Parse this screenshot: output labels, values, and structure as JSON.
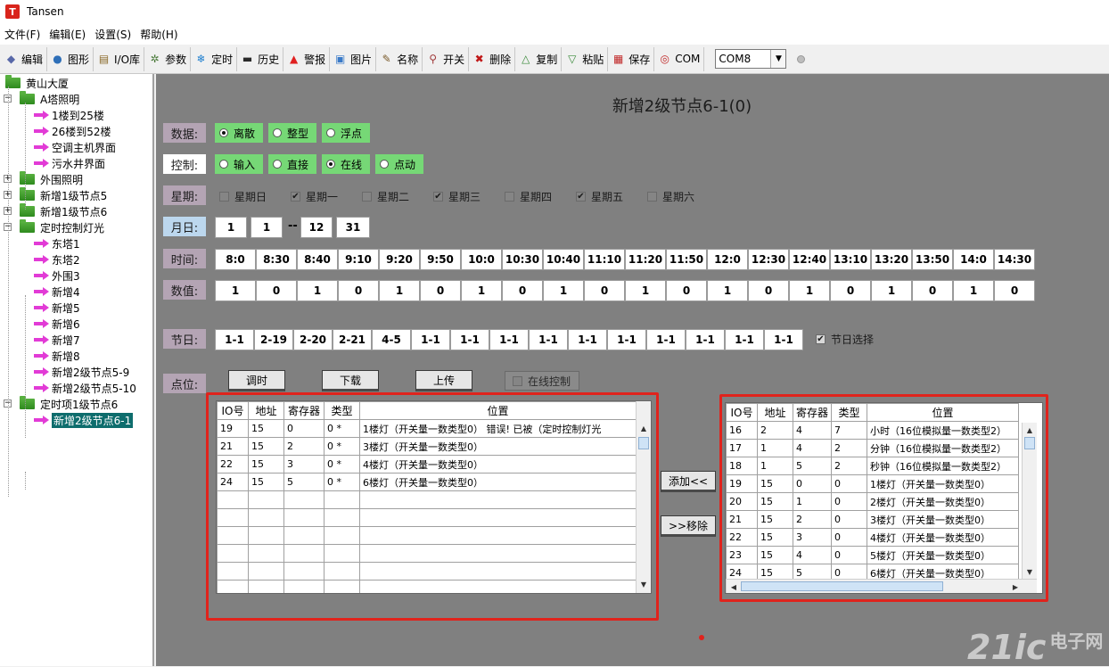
{
  "app": {
    "title": "Tansen",
    "icon_letter": "T"
  },
  "menu": [
    "文件(F)",
    "编辑(E)",
    "设置(S)",
    "帮助(H)"
  ],
  "toolbar": [
    {
      "label": "编辑",
      "icon": "edit-icon",
      "glyph": "◆",
      "color": "#5868a8"
    },
    {
      "label": "图形",
      "icon": "globe-icon",
      "glyph": "●",
      "color": "#2f6fb8"
    },
    {
      "label": "I/O库",
      "icon": "library-icon",
      "glyph": "▤",
      "color": "#8a6a2a"
    },
    {
      "label": "参数",
      "icon": "gear-icon",
      "glyph": "✲",
      "color": "#4a7a3a"
    },
    {
      "label": "定时",
      "icon": "snowflake-icon",
      "glyph": "❄",
      "color": "#1f7fcf"
    },
    {
      "label": "历史",
      "icon": "monitor-icon",
      "glyph": "▬",
      "color": "#2a2a2a"
    },
    {
      "label": "警报",
      "icon": "alarm-icon",
      "glyph": "▲",
      "color": "#e02020"
    },
    {
      "label": "图片",
      "icon": "picture-icon",
      "glyph": "▣",
      "color": "#3a7ac8"
    },
    {
      "label": "名称",
      "icon": "name-edit-icon",
      "glyph": "✎",
      "color": "#7a5a2a"
    },
    {
      "label": "开关",
      "icon": "search-icon",
      "glyph": "⚲",
      "color": "#a03a3a"
    },
    {
      "label": "删除",
      "icon": "delete-icon",
      "glyph": "✖",
      "color": "#c01818"
    },
    {
      "label": "复制",
      "icon": "up-arrow-icon",
      "glyph": "△",
      "color": "#3a8a3a"
    },
    {
      "label": "粘贴",
      "icon": "down-arrow-icon",
      "glyph": "▽",
      "color": "#3a8a3a"
    },
    {
      "label": "保存",
      "icon": "calendar-icon",
      "glyph": "▦",
      "color": "#c02828"
    },
    {
      "label": "COM",
      "icon": "com-icon",
      "glyph": "◎",
      "color": "#c02828"
    }
  ],
  "com_port": "COM8",
  "tree": [
    {
      "label": "黄山大厦",
      "level": 0,
      "type": "folder",
      "exp": ""
    },
    {
      "label": "A塔照明",
      "level": 1,
      "type": "folder",
      "exp": "−"
    },
    {
      "label": "1楼到25楼",
      "level": 2,
      "type": "arrow"
    },
    {
      "label": "26楼到52楼",
      "level": 2,
      "type": "arrow"
    },
    {
      "label": "空调主机界面",
      "level": 2,
      "type": "arrow"
    },
    {
      "label": "污水井界面",
      "level": 2,
      "type": "arrow"
    },
    {
      "label": "外围照明",
      "level": 1,
      "type": "folder",
      "exp": "+"
    },
    {
      "label": "新增1级节点5",
      "level": 1,
      "type": "folder",
      "exp": "+"
    },
    {
      "label": "新增1级节点6",
      "level": 1,
      "type": "folder",
      "exp": "+"
    },
    {
      "label": "定时控制灯光",
      "level": 1,
      "type": "folder",
      "exp": "−"
    },
    {
      "label": "东塔1",
      "level": 2,
      "type": "arrow"
    },
    {
      "label": "东塔2",
      "level": 2,
      "type": "arrow"
    },
    {
      "label": "外围3",
      "level": 2,
      "type": "arrow"
    },
    {
      "label": "新增4",
      "level": 2,
      "type": "arrow"
    },
    {
      "label": "新增5",
      "level": 2,
      "type": "arrow"
    },
    {
      "label": "新增6",
      "level": 2,
      "type": "arrow"
    },
    {
      "label": "新增7",
      "level": 2,
      "type": "arrow"
    },
    {
      "label": "新增8",
      "level": 2,
      "type": "arrow"
    },
    {
      "label": "新增2级节点5-9",
      "level": 2,
      "type": "arrow"
    },
    {
      "label": "新增2级节点5-10",
      "level": 2,
      "type": "arrow"
    },
    {
      "label": "定时项1级节点6",
      "level": 1,
      "type": "folder",
      "exp": "−"
    },
    {
      "label": "新增2级节点6-1",
      "level": 2,
      "type": "arrow",
      "selected": true
    }
  ],
  "page_title": "新增2级节点6-1(0)",
  "labels": {
    "data": "数据:",
    "control": "控制:",
    "week": "星期:",
    "monthday": "月日:",
    "time": "时间:",
    "value": "数值:",
    "holiday": "节日:",
    "point": "点位:"
  },
  "data_types": [
    {
      "label": "离散",
      "on": true
    },
    {
      "label": "整型",
      "on": false
    },
    {
      "label": "浮点",
      "on": false
    }
  ],
  "control_modes": [
    {
      "label": "输入",
      "on": false
    },
    {
      "label": "直接",
      "on": false
    },
    {
      "label": "在线",
      "on": true
    },
    {
      "label": "点动",
      "on": false
    }
  ],
  "weekdays": [
    {
      "label": "星期日",
      "on": false
    },
    {
      "label": "星期一",
      "on": true
    },
    {
      "label": "星期二",
      "on": false
    },
    {
      "label": "星期三",
      "on": true
    },
    {
      "label": "星期四",
      "on": false
    },
    {
      "label": "星期五",
      "on": true
    },
    {
      "label": "星期六",
      "on": false
    }
  ],
  "monthday": {
    "from_m": "1",
    "from_d": "1",
    "sep": "--",
    "to_m": "12",
    "to_d": "31"
  },
  "times": [
    "8:0",
    "8:30",
    "8:40",
    "9:10",
    "9:20",
    "9:50",
    "10:0",
    "10:30",
    "10:40",
    "11:10",
    "11:20",
    "11:50",
    "12:0",
    "12:30",
    "12:40",
    "13:10",
    "13:20",
    "13:50",
    "14:0",
    "14:30"
  ],
  "values": [
    "1",
    "0",
    "1",
    "0",
    "1",
    "0",
    "1",
    "0",
    "1",
    "0",
    "1",
    "0",
    "1",
    "0",
    "1",
    "0",
    "1",
    "0",
    "1",
    "0"
  ],
  "holidays": [
    "1-1",
    "2-19",
    "2-20",
    "2-21",
    "4-5",
    "1-1",
    "1-1",
    "1-1",
    "1-1",
    "1-1",
    "1-1",
    "1-1",
    "1-1",
    "1-1",
    "1-1"
  ],
  "holiday_select": {
    "label": "节日选择",
    "on": true
  },
  "buttons": {
    "adjust": "调时",
    "download": "下载",
    "upload": "上传",
    "online": "在线控制",
    "add": "添加<<",
    "remove": ">>移除"
  },
  "left_table": {
    "headers": [
      "IO号",
      "地址",
      "寄存器",
      "类型",
      "位置"
    ],
    "rows": [
      [
        "19",
        "15",
        "0",
        "0 *",
        "1楼灯（开关量一数类型0）  错误! 已被（定时控制灯光"
      ],
      [
        "21",
        "15",
        "2",
        "0 *",
        "3楼灯（开关量一数类型0）"
      ],
      [
        "22",
        "15",
        "3",
        "0 *",
        "4楼灯（开关量一数类型0）"
      ],
      [
        "24",
        "15",
        "5",
        "0 *",
        "6楼灯（开关量一数类型0）"
      ]
    ]
  },
  "right_table": {
    "headers": [
      "IO号",
      "地址",
      "寄存器",
      "类型",
      "位置"
    ],
    "rows": [
      [
        "16",
        "2",
        "4",
        "7",
        "小时（16位模拟量一数类型2）"
      ],
      [
        "17",
        "1",
        "4",
        "2",
        "分钟（16位模拟量一数类型2）"
      ],
      [
        "18",
        "1",
        "5",
        "2",
        "秒钟（16位模拟量一数类型2）"
      ],
      [
        "19",
        "15",
        "0",
        "0",
        "1楼灯（开关量一数类型0）"
      ],
      [
        "20",
        "15",
        "1",
        "0",
        "2楼灯（开关量一数类型0）"
      ],
      [
        "21",
        "15",
        "2",
        "0",
        "3楼灯（开关量一数类型0）"
      ],
      [
        "22",
        "15",
        "3",
        "0",
        "4楼灯（开关量一数类型0）"
      ],
      [
        "23",
        "15",
        "4",
        "0",
        "5楼灯（开关量一数类型0）"
      ],
      [
        "24",
        "15",
        "5",
        "0",
        "6楼灯（开关量一数类型0）"
      ]
    ]
  },
  "watermark": {
    "brand": "21ic",
    "cn": "电子网"
  }
}
